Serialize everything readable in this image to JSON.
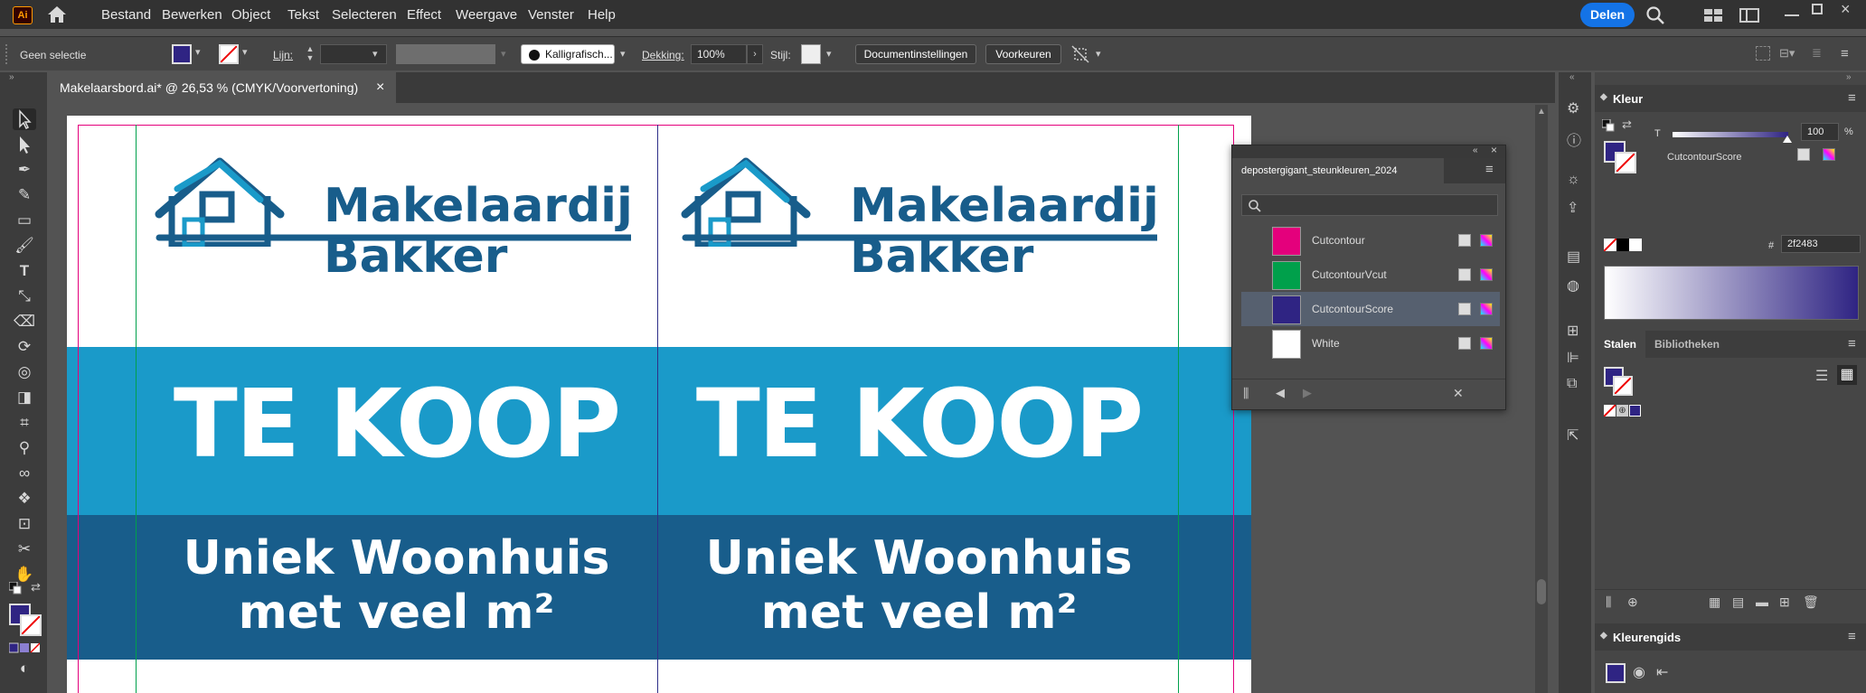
{
  "menubar": {
    "app_badge": "Ai",
    "items": [
      "Bestand",
      "Bewerken",
      "Object",
      "Tekst",
      "Selecteren",
      "Effect",
      "Weergave",
      "Venster",
      "Help"
    ],
    "share_label": "Delen"
  },
  "controlbar": {
    "selection_label": "Geen selectie",
    "stroke_label": "Lijn:",
    "brush_label": "Kalligrafisch...",
    "opacity_label": "Dekking:",
    "opacity_value": "100%",
    "style_label": "Stijl:",
    "doc_settings": "Documentinstellingen",
    "preferences": "Voorkeuren",
    "fill_color": "#2f2483"
  },
  "tab": {
    "title": "Makelaarsbord.ai* @ 26,53 % (CMYK/Voorvertoning)",
    "close": "×"
  },
  "artboard": {
    "brand_line1": "Makelaardij",
    "brand_line2": "Bakker",
    "headline": "TE KOOP",
    "sub_line1": "Uniek Woonhuis",
    "sub_line2": "met veel m²",
    "colors": {
      "light_band": "#1a9ac9",
      "dark_band": "#185d8b"
    }
  },
  "swatch_panel": {
    "title": "depostergigant_steunkleuren_2024",
    "search_placeholder": "",
    "swatches": [
      {
        "name": "Cutcontour",
        "color": "#e4007c"
      },
      {
        "name": "CutcontourVcut",
        "color": "#00a04b"
      },
      {
        "name": "CutcontourScore",
        "color": "#2f2483"
      },
      {
        "name": "White",
        "color": "#ffffff"
      }
    ]
  },
  "color_panel": {
    "title": "Kleur",
    "tint_label": "T",
    "tint_value": "100",
    "tint_unit": "%",
    "swatch_name": "CutcontourScore",
    "hex_label": "#",
    "hex_value": "2f2483"
  },
  "swatches_panel": {
    "tab_active": "Stalen",
    "tab_inactive": "Bibliotheken"
  },
  "color_guide": {
    "title": "Kleurengids"
  }
}
